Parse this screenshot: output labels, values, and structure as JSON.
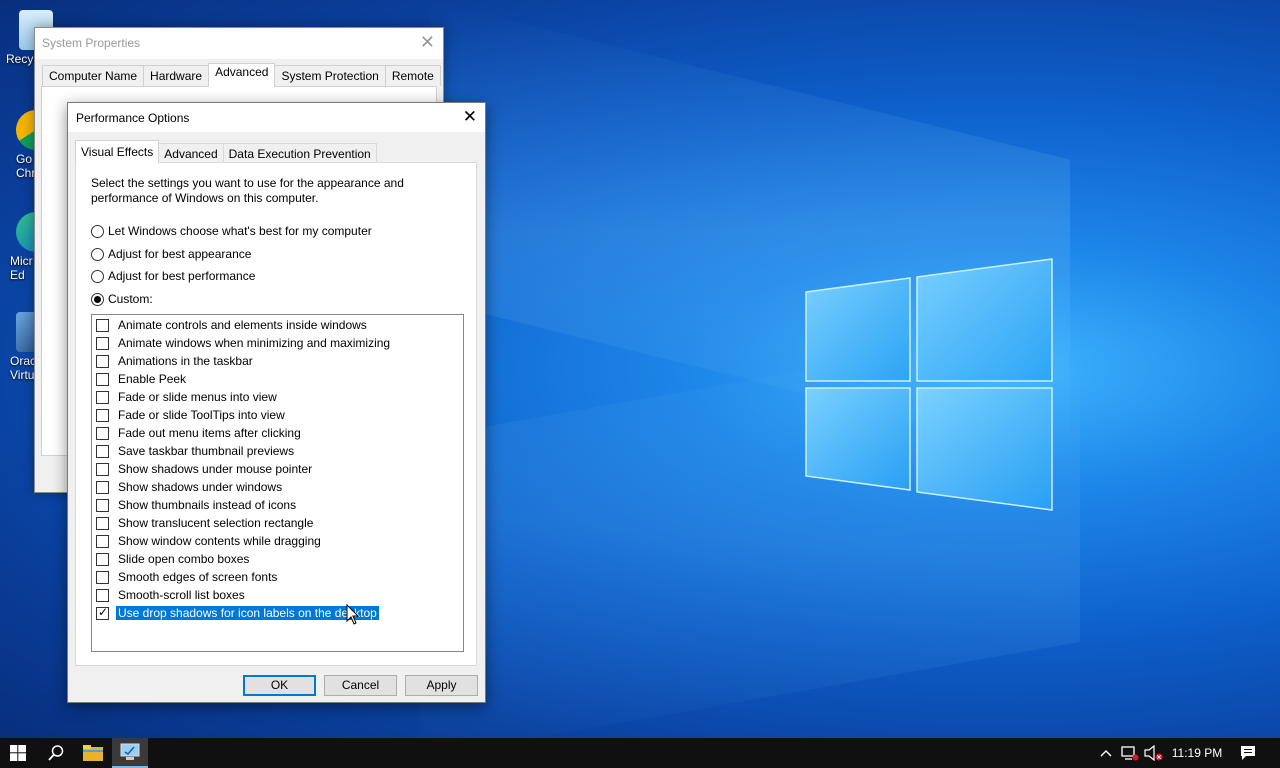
{
  "desktop": {
    "icons": [
      {
        "label": "Recy"
      },
      {
        "label": "Go\nChr"
      },
      {
        "label": "Micr\nEd"
      },
      {
        "label": "Orac\nVirtu"
      }
    ]
  },
  "system_properties": {
    "title": "System Properties",
    "tabs": [
      {
        "label": "Computer Name"
      },
      {
        "label": "Hardware"
      },
      {
        "label": "Advanced"
      },
      {
        "label": "System Protection"
      },
      {
        "label": "Remote"
      }
    ]
  },
  "performance_options": {
    "title": "Performance Options",
    "tabs": [
      {
        "label": "Visual Effects"
      },
      {
        "label": "Advanced"
      },
      {
        "label": "Data Execution Prevention"
      }
    ],
    "description": "Select the settings you want to use for the appearance and performance of Windows on this computer.",
    "radios": [
      {
        "label": "Let Windows choose what's best for my computer",
        "checked": false
      },
      {
        "label": "Adjust for best appearance",
        "checked": false
      },
      {
        "label": "Adjust for best performance",
        "checked": false
      },
      {
        "label": "Custom:",
        "checked": true
      }
    ],
    "effects": [
      {
        "label": "Animate controls and elements inside windows",
        "checked": false
      },
      {
        "label": "Animate windows when minimizing and maximizing",
        "checked": false
      },
      {
        "label": "Animations in the taskbar",
        "checked": false
      },
      {
        "label": "Enable Peek",
        "checked": false
      },
      {
        "label": "Fade or slide menus into view",
        "checked": false
      },
      {
        "label": "Fade or slide ToolTips into view",
        "checked": false
      },
      {
        "label": "Fade out menu items after clicking",
        "checked": false
      },
      {
        "label": "Save taskbar thumbnail previews",
        "checked": false
      },
      {
        "label": "Show shadows under mouse pointer",
        "checked": false
      },
      {
        "label": "Show shadows under windows",
        "checked": false
      },
      {
        "label": "Show thumbnails instead of icons",
        "checked": false
      },
      {
        "label": "Show translucent selection rectangle",
        "checked": false
      },
      {
        "label": "Show window contents while dragging",
        "checked": false
      },
      {
        "label": "Slide open combo boxes",
        "checked": false
      },
      {
        "label": "Smooth edges of screen fonts",
        "checked": false
      },
      {
        "label": "Smooth-scroll list boxes",
        "checked": false
      },
      {
        "label": "Use drop shadows for icon labels on the desktop",
        "checked": true,
        "selected": true
      }
    ],
    "buttons": {
      "ok": "OK",
      "cancel": "Cancel",
      "apply": "Apply"
    }
  },
  "taskbar": {
    "clock": "11:19 PM",
    "icons": [
      "windows-start-icon",
      "search-icon",
      "file-explorer-icon",
      "system-properties-icon"
    ],
    "tray": [
      "chevron-up-icon",
      "network-icon",
      "volume-muted-icon",
      "notification-icon"
    ]
  },
  "colors": {
    "selection": "#0078d7",
    "taskbar": "#101010"
  }
}
